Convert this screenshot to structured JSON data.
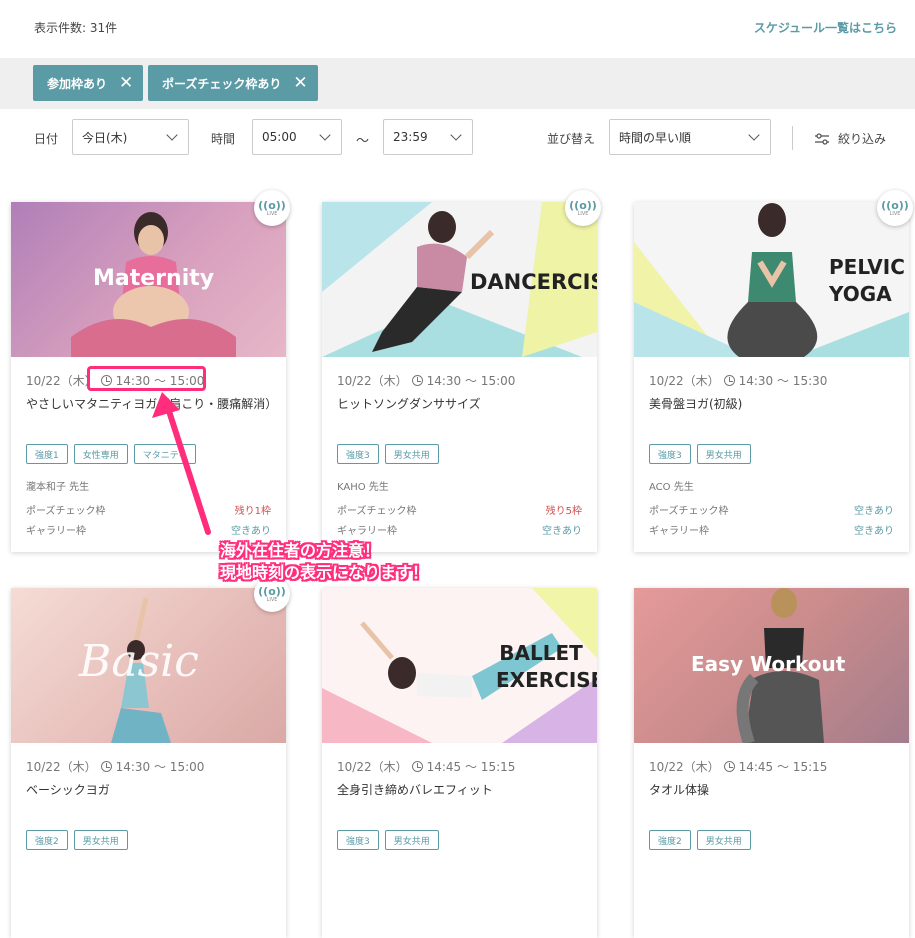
{
  "header": {
    "count": "表示件数: 31件",
    "schedule_link": "スケジュール一覧はこちら"
  },
  "filters": [
    {
      "label": "参加枠あり"
    },
    {
      "label": "ポーズチェック枠あり"
    }
  ],
  "controls": {
    "date_label": "日付",
    "date_value": "今日(木)",
    "time_label": "時間",
    "time_from": "05:00",
    "tilde": "〜",
    "time_to": "23:59",
    "sort_label": "並び替え",
    "sort_value": "時間の早い順",
    "refine_label": "絞り込み"
  },
  "live_badge": {
    "icon": "((o))",
    "text": "LIVE"
  },
  "cards": [
    {
      "thumb_title": "Maternity",
      "thumb_bg": "#c28aa8",
      "datetime": "10/22（木）",
      "time": "14:30 〜 15:00",
      "title": "やさしいマタニティヨガ（肩こり・腰痛解消）",
      "tags": [
        "強度1",
        "女性専用",
        "マタニティ"
      ],
      "teacher": "瀧本和子 先生",
      "pose_label": "ポーズチェック枠",
      "pose_value": "残り1枠",
      "gallery_label": "ギャラリー枠",
      "gallery_value": "空きあり",
      "live": true
    },
    {
      "thumb_title": "DANCERCISE",
      "thumb_bg": "#f3f3f3",
      "datetime": "10/22（木）",
      "time": "14:30 〜 15:00",
      "title": "ヒットソングダンササイズ",
      "tags": [
        "強度3",
        "男女共用"
      ],
      "teacher": "KAHO 先生",
      "pose_label": "ポーズチェック枠",
      "pose_value": "残り5枠",
      "gallery_label": "ギャラリー枠",
      "gallery_value": "空きあり",
      "live": true
    },
    {
      "thumb_title": "PELVIC YOGA",
      "thumb_bg": "#f5f5f5",
      "datetime": "10/22（木）",
      "time": "14:30 〜 15:30",
      "title": "美骨盤ヨガ(初級)",
      "tags": [
        "強度3",
        "男女共用"
      ],
      "teacher": "ACO 先生",
      "pose_label": "ポーズチェック枠",
      "pose_value": "空きあり",
      "gallery_label": "ギャラリー枠",
      "gallery_value": "空きあり",
      "live": true
    },
    {
      "thumb_title": "Basic",
      "thumb_bg": "#e9c9c4",
      "datetime": "10/22（木）",
      "time": "14:30 〜 15:00",
      "title": "ベーシックヨガ",
      "tags": [
        "強度2",
        "男女共用"
      ],
      "live": true
    },
    {
      "thumb_title": "BALLET EXERCISE",
      "thumb_bg": "#fbe3e6",
      "datetime": "10/22（木）",
      "time": "14:45 〜 15:15",
      "title": "全身引き締めバレエフィット",
      "tags": [
        "強度3",
        "男女共用"
      ],
      "live": false
    },
    {
      "thumb_title": "Easy Workout",
      "thumb_bg": "#c98b8b",
      "datetime": "10/22（木）",
      "time": "14:45 〜 15:15",
      "title": "タオル体操",
      "tags": [
        "強度2",
        "男女共用"
      ],
      "live": false
    }
  ],
  "annotation": {
    "line1": "海外在住者の方注意！",
    "line2": "現地時刻の表示になります！",
    "color": "#ff2d7c"
  },
  "colors": {
    "accent": "#5a9ba6",
    "warn": "#d05050"
  }
}
